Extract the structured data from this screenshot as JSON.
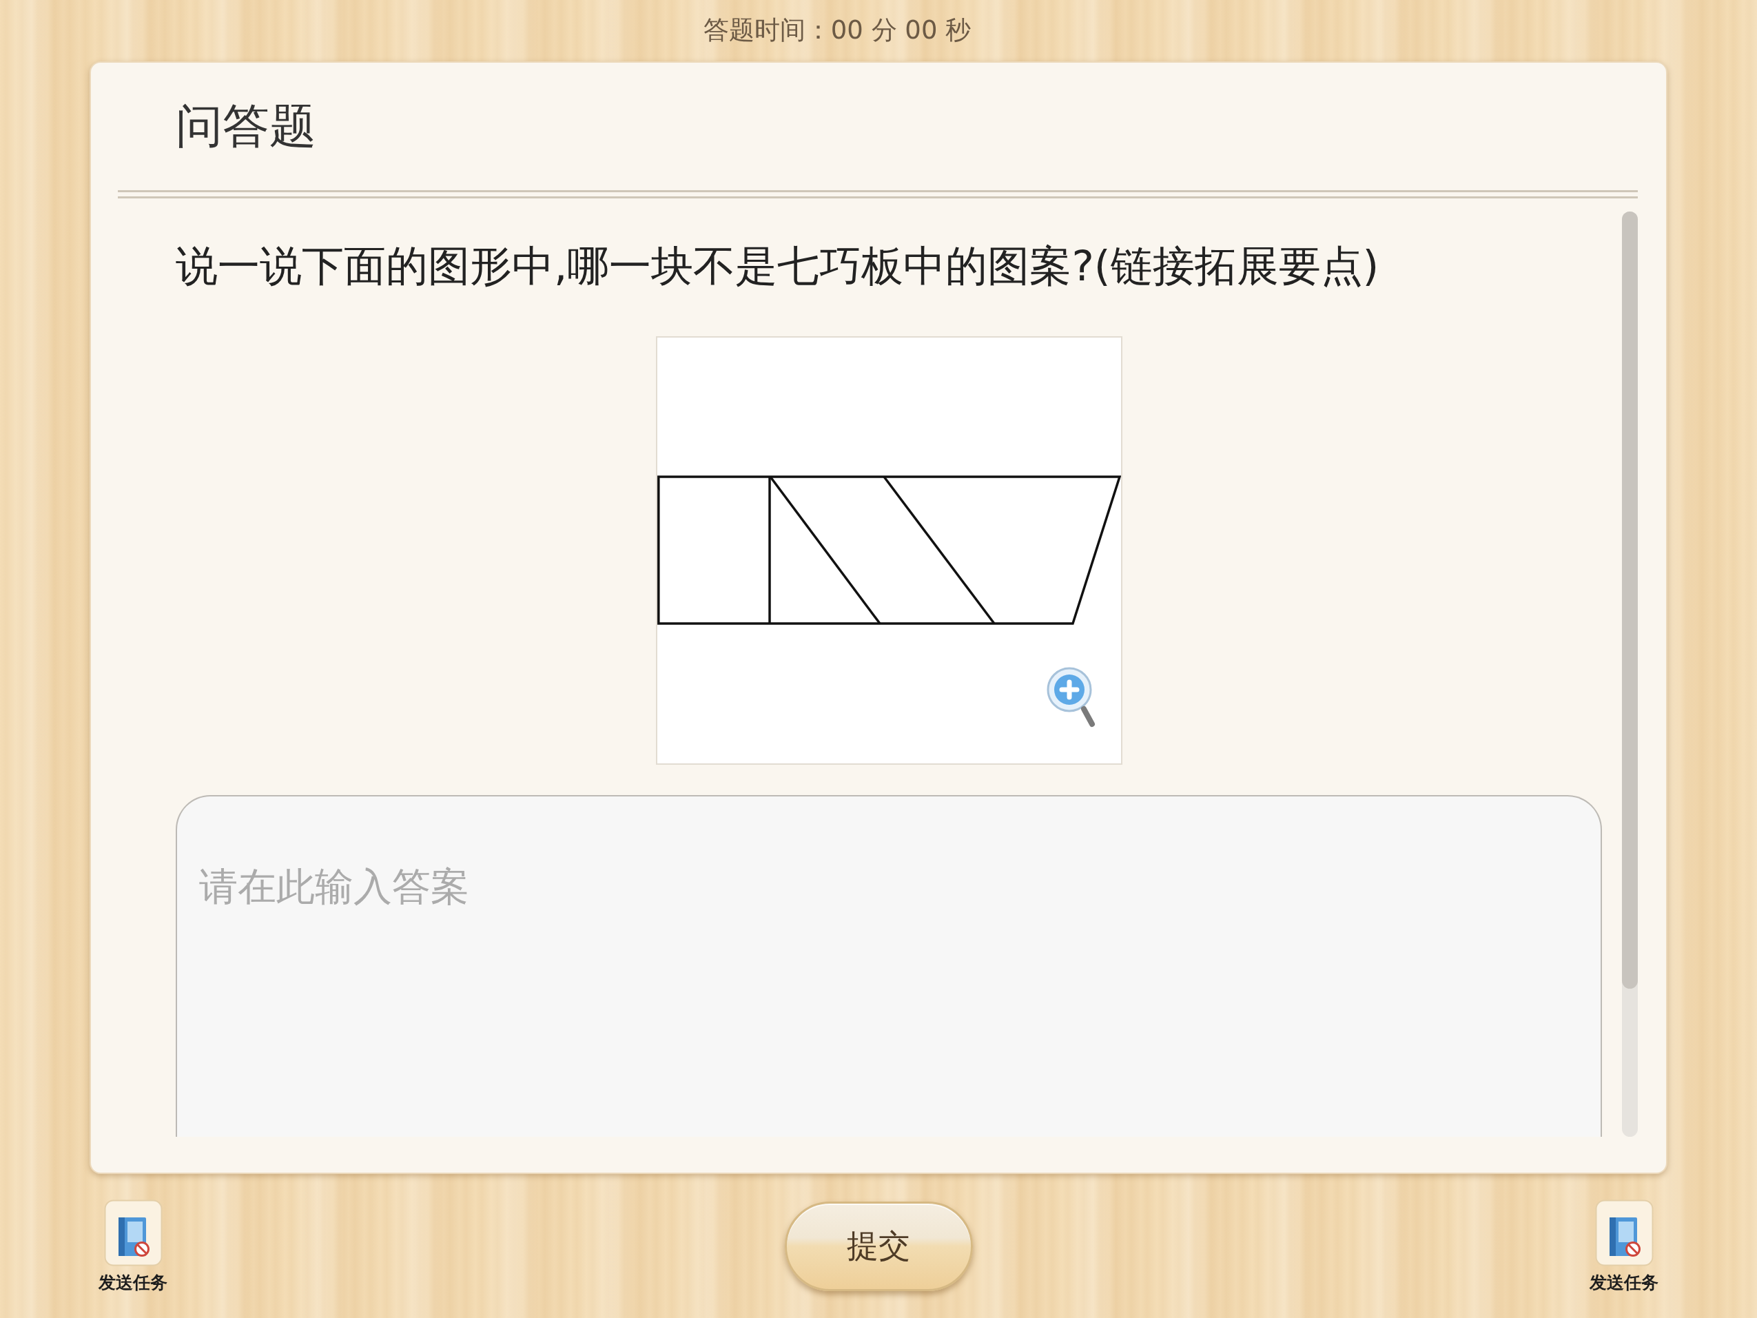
{
  "timer": {
    "text": "答题时间：00 分 00 秒"
  },
  "question_card": {
    "title": "问答题",
    "question": "说一说下面的图形中,哪一块不是七巧板中的图案?(链接拓展要点)",
    "answer_field": {
      "placeholder": "请在此输入答案"
    }
  },
  "submit_button": {
    "label": "提交"
  },
  "task_buttons": [
    {
      "label": "发送任务"
    },
    {
      "label": "发送任务"
    }
  ]
}
